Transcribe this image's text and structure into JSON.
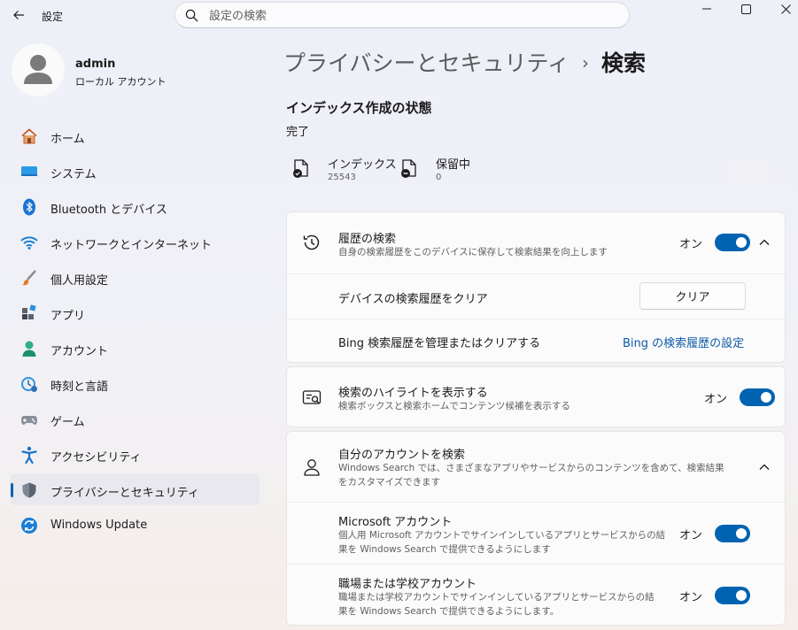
{
  "app": {
    "title": "設定",
    "search_placeholder": "設定の検索"
  },
  "profile": {
    "name": "admin",
    "account_type": "ローカル アカウント"
  },
  "sidebar": {
    "items": [
      {
        "label": "ホーム",
        "icon": "home-icon"
      },
      {
        "label": "システム",
        "icon": "system-icon"
      },
      {
        "label": "Bluetooth とデバイス",
        "icon": "bluetooth-icon"
      },
      {
        "label": "ネットワークとインターネット",
        "icon": "wifi-icon"
      },
      {
        "label": "個人用設定",
        "icon": "brush-icon"
      },
      {
        "label": "アプリ",
        "icon": "apps-icon"
      },
      {
        "label": "アカウント",
        "icon": "account-icon"
      },
      {
        "label": "時刻と言語",
        "icon": "time-language-icon"
      },
      {
        "label": "ゲーム",
        "icon": "gamepad-icon"
      },
      {
        "label": "アクセシビリティ",
        "icon": "accessibility-icon"
      },
      {
        "label": "プライバシーとセキュリティ",
        "icon": "shield-icon",
        "selected": true
      },
      {
        "label": "Windows Update",
        "icon": "update-icon"
      }
    ]
  },
  "header": {
    "parent": "プライバシーとセキュリティ",
    "separator": "›",
    "current": "検索"
  },
  "indexing": {
    "title": "インデックス作成の状態",
    "status": "完了",
    "indexed_label": "インデックス",
    "indexed_value": "25543",
    "pending_label": "保留中",
    "pending_value": "0"
  },
  "history": {
    "title": "履歴の検索",
    "description": "自身の検索履歴をこのデバイスに保存して検索結果を向上します",
    "toggle_state": "オン",
    "clear_row_label": "デバイスの検索履歴をクリア",
    "clear_button": "クリア",
    "bing_row_label": "Bing 検索履歴を管理またはクリアする",
    "bing_link": "Bing の検索履歴の設定"
  },
  "highlights": {
    "title": "検索のハイライトを表示する",
    "description": "検索ボックスと検索ホームでコンテンツ候補を表示する",
    "toggle_state": "オン"
  },
  "accounts": {
    "title": "自分のアカウントを検索",
    "description": "Windows Search では、さまざまなアプリやサービスからのコンテンツを含めて、検索結果をカスタマイズできます",
    "microsoft": {
      "title": "Microsoft アカウント",
      "description": "個人用 Microsoft アカウントでサインインしているアプリとサービスからの結果を Windows Search で提供できるようにします",
      "toggle_state": "オン"
    },
    "work_school": {
      "title": "職場または学校アカウント",
      "description": "職場または学校アカウントでサインインしているアプリとサービスからの結果を Windows Search で提供できるようにします。",
      "toggle_state": "オン"
    }
  },
  "colors": {
    "accent": "#0063b1",
    "link": "#0e5aa7"
  }
}
